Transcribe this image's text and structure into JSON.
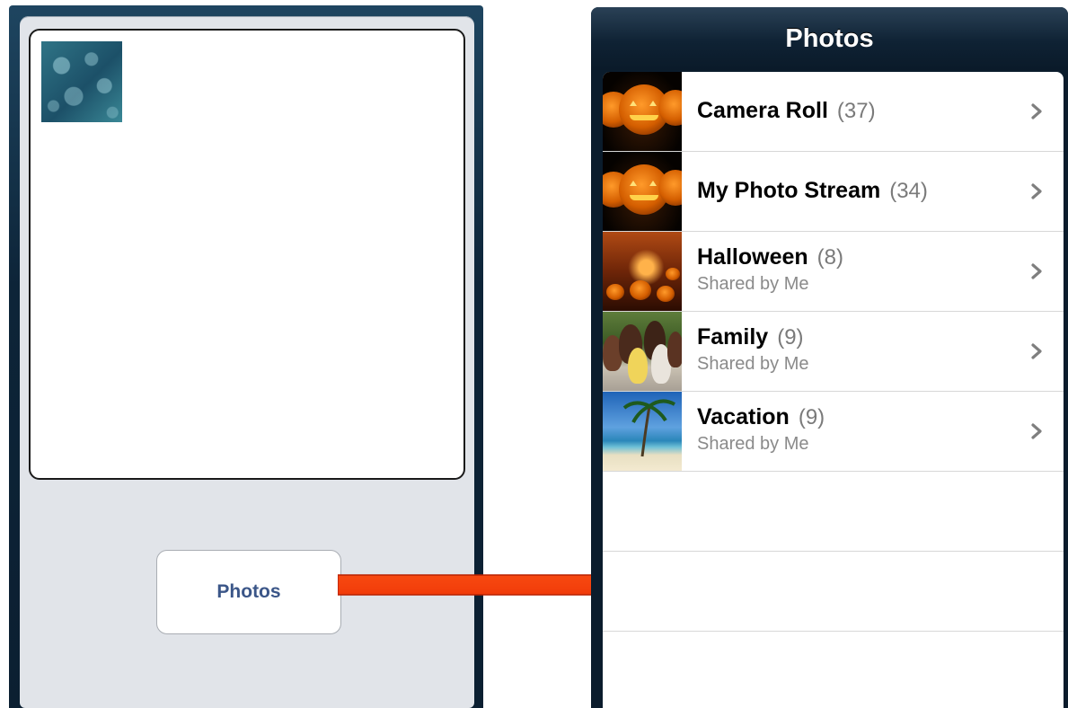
{
  "left": {
    "photos_button_label": "Photos"
  },
  "right": {
    "nav_title": "Photos",
    "albums": [
      {
        "name": "Camera Roll",
        "count": "(37)",
        "subtitle": "",
        "thumb": "pumpkins"
      },
      {
        "name": "My Photo Stream",
        "count": "(34)",
        "subtitle": "",
        "thumb": "pumpkins"
      },
      {
        "name": "Halloween",
        "count": "(8)",
        "subtitle": "Shared by Me",
        "thumb": "halloween-forest"
      },
      {
        "name": "Family",
        "count": "(9)",
        "subtitle": "Shared by Me",
        "thumb": "family"
      },
      {
        "name": "Vacation",
        "count": "(9)",
        "subtitle": "Shared by Me",
        "thumb": "beach"
      }
    ]
  },
  "colors": {
    "arrow": "#ff3300",
    "button_text": "#3b5688"
  }
}
